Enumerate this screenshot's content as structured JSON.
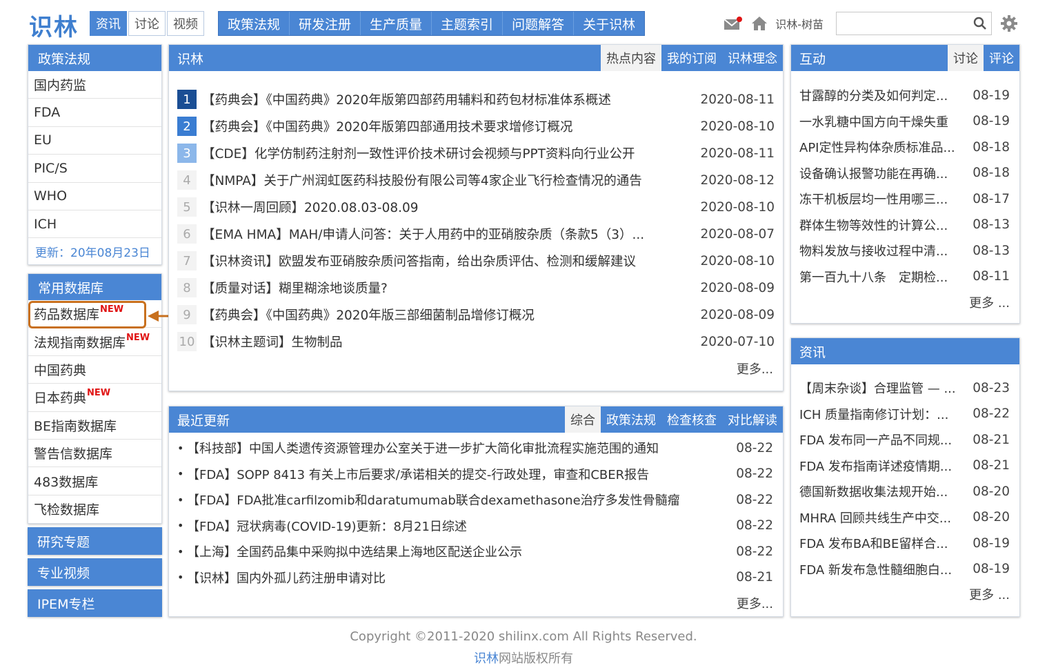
{
  "header": {
    "logo": "识林",
    "top_tabs": [
      "资讯",
      "讨论",
      "视频"
    ],
    "main_nav": [
      "政策法规",
      "研发注册",
      "生产质量",
      "主题索引",
      "问题解答",
      "关于识林"
    ],
    "user": "识林-树苗",
    "search_placeholder": ""
  },
  "sidebar": {
    "policy": {
      "title": "政策法规",
      "items": [
        "国内药监",
        "FDA",
        "EU",
        "PIC/S",
        "WHO",
        "ICH"
      ],
      "update": "更新：20年08月23日"
    },
    "database": {
      "title": "常用数据库",
      "items": [
        {
          "label": "药品数据库",
          "badge": "NEW"
        },
        {
          "label": "法规指南数据库",
          "badge": "NEW"
        },
        {
          "label": "中国药典",
          "badge": ""
        },
        {
          "label": "日本药典",
          "badge": "NEW"
        },
        {
          "label": "BE指南数据库",
          "badge": ""
        },
        {
          "label": "警告信数据库",
          "badge": ""
        },
        {
          "label": "483数据库",
          "badge": ""
        },
        {
          "label": "飞检数据库",
          "badge": ""
        }
      ]
    },
    "collapsed": [
      "研究专题",
      "专业视频",
      "IPEM专栏"
    ]
  },
  "news": {
    "title": "识林",
    "tabs": [
      "热点内容",
      "我的订阅",
      "识林理念"
    ],
    "items": [
      {
        "rank": "1",
        "title": "【药典会】《中国药典》2020年版第四部药用辅料和药包材标准体系概述",
        "date": "2020-08-11"
      },
      {
        "rank": "2",
        "title": "【药典会】《中国药典》2020年版第四部通用技术要求增修订概况",
        "date": "2020-08-10"
      },
      {
        "rank": "3",
        "title": "【CDE】化学仿制药注射剂一致性评价技术研讨会视频与PPT资料向行业公开",
        "date": "2020-08-11"
      },
      {
        "rank": "4",
        "title": "【NMPA】关于广州润虹医药科技股份有限公司等4家企业飞行检查情况的通告",
        "date": "2020-08-12"
      },
      {
        "rank": "5",
        "title": "【识林一周回顾】2020.08.03-08.09",
        "date": "2020-08-10"
      },
      {
        "rank": "6",
        "title": "【EMA HMA】MAH/申请人问答：关于人用药中的亚硝胺杂质（条款5（3）...",
        "date": "2020-08-07"
      },
      {
        "rank": "7",
        "title": "【识林资讯】欧盟发布亚硝胺杂质问答指南，给出杂质评估、检测和缓解建议",
        "date": "2020-08-10"
      },
      {
        "rank": "8",
        "title": "【质量对话】糊里糊涂地谈质量?",
        "date": "2020-08-09"
      },
      {
        "rank": "9",
        "title": "【药典会】《中国药典》2020年版三部细菌制品增修订概况",
        "date": "2020-08-09"
      },
      {
        "rank": "10",
        "title": "【识林主题词】生物制品",
        "date": "2020-07-10"
      }
    ],
    "more": "更多..."
  },
  "updates": {
    "title": "最近更新",
    "tabs": [
      "综合",
      "政策法规",
      "检查核查",
      "对比解读"
    ],
    "items": [
      {
        "title": "【科技部】中国人类遗传资源管理办公室关于进一步扩大简化审批流程实施范围的通知",
        "date": "08-22"
      },
      {
        "title": "【FDA】SOPP 8413 有关上市后要求/承诺相关的提交-行政处理，审查和CBER报告",
        "date": "08-22"
      },
      {
        "title": "【FDA】FDA批准carfilzomib和daratumumab联合dexamethasone治疗多发性骨髓瘤",
        "date": "08-22"
      },
      {
        "title": "【FDA】冠状病毒(COVID-19)更新：8月21日综述",
        "date": "08-22"
      },
      {
        "title": "【上海】全国药品集中采购拟中选结果上海地区配送企业公示",
        "date": "08-22"
      },
      {
        "title": "【识林】国内外孤儿药注册申请对比",
        "date": "08-21"
      }
    ],
    "more": "更多..."
  },
  "interaction": {
    "title": "互动",
    "tabs": [
      "讨论",
      "评论"
    ],
    "items": [
      {
        "title": "甘露醇的分类及如何判定...",
        "date": "08-19"
      },
      {
        "title": "一水乳糖中国方向干燥失重",
        "date": "08-19"
      },
      {
        "title": "API定性异构体杂质标准品...",
        "date": "08-18"
      },
      {
        "title": "设备确认报警功能在再确...",
        "date": "08-18"
      },
      {
        "title": "冻干机板层均一性用哪三...",
        "date": "08-17"
      },
      {
        "title": "群体生物等效性的计算公...",
        "date": "08-13"
      },
      {
        "title": "物料发放与接收过程中清...",
        "date": "08-13"
      },
      {
        "title": "第一百九十八条　定期检...",
        "date": "08-11"
      }
    ],
    "more": "更多 ..."
  },
  "info": {
    "title": "资讯",
    "items": [
      {
        "title": "【周末杂谈】合理监管 — ...",
        "date": "08-23"
      },
      {
        "title": "ICH 质量指南修订计划：...",
        "date": "08-22"
      },
      {
        "title": "FDA 发布同一产品不同规...",
        "date": "08-21"
      },
      {
        "title": "FDA 发布指南详述疫情期...",
        "date": "08-21"
      },
      {
        "title": "德国新数据收集法规开始...",
        "date": "08-20"
      },
      {
        "title": "MHRA 回顾共线生产中交...",
        "date": "08-20"
      },
      {
        "title": "FDA 发布BA和BE留样合...",
        "date": "08-19"
      },
      {
        "title": "FDA 新发布急性髓细胞白...",
        "date": "08-19"
      }
    ],
    "more": "更多 ..."
  },
  "footer": {
    "copyright": "Copyright ©2011-2020 shilinx.com All Rights Reserved.",
    "brand": "识林",
    "rights": "网站版权所有"
  },
  "colors": {
    "accent": "#4a86d4",
    "highlight": "#c8701e",
    "badge": "#e01414"
  }
}
